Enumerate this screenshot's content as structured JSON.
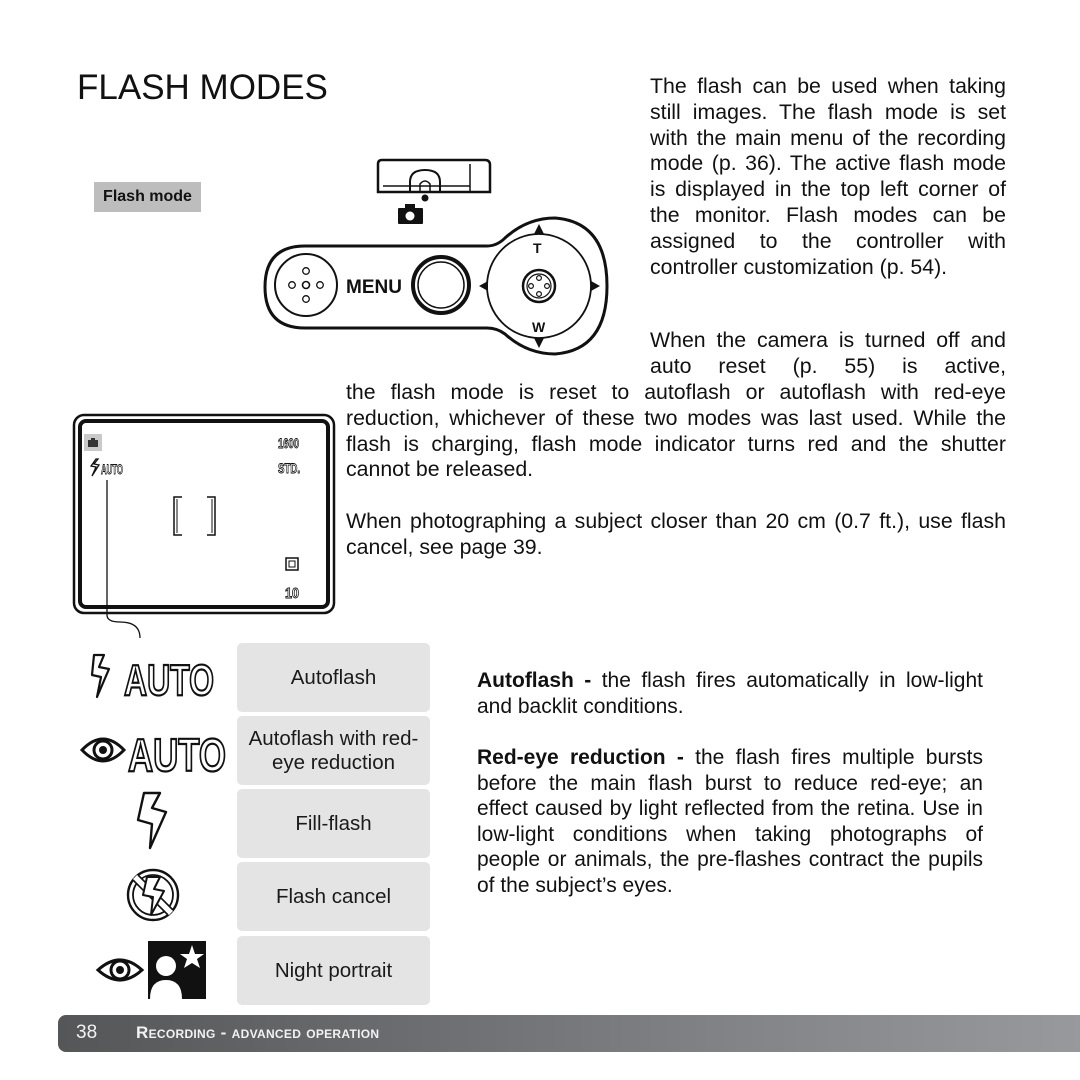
{
  "page": {
    "title": "FLASH MODES",
    "callout_label": "Flash mode",
    "intro_paragraph": "The flash can be used when taking still images. The flash mode is set with the main menu of the recording mode (p. 36). The active flash mode is displayed in the top left corner of the monitor. Flash modes can be assigned to the controller with controller customization (p. 54).",
    "reset_paragraph_part1": "When the camera is turned off and auto reset (p. 55) is active,",
    "reset_paragraph_part2": "the flash mode is reset to autoflash or autoflash with red-eye reduction, whichever of these two modes was last used. While the flash is charging, flash mode indicator turns red and the shutter cannot be released.",
    "close_subject_paragraph": "When photographing a subject closer than 20 cm (0.7 ft.), use flash cancel, see page 39."
  },
  "camera_diagram": {
    "menu_label": "MENU",
    "tele_label": "T",
    "wide_label": "W"
  },
  "monitor": {
    "iso": "1600",
    "quality": "STD.",
    "flash_indicator": "AUTO",
    "frame_count": "10"
  },
  "flash_modes": [
    {
      "icon": "autoflash-icon",
      "icon_text": "AUTO",
      "label": "Autoflash"
    },
    {
      "icon": "red-eye-autoflash-icon",
      "icon_text": "AUTO",
      "label": "Autoflash with red-eye reduction"
    },
    {
      "icon": "fill-flash-icon",
      "icon_text": "",
      "label": "Fill-flash"
    },
    {
      "icon": "flash-cancel-icon",
      "icon_text": "",
      "label": "Flash cancel"
    },
    {
      "icon": "night-portrait-icon",
      "icon_text": "",
      "label": "Night portrait"
    }
  ],
  "descriptions": [
    {
      "term": "Autoflash -",
      "text": " the flash fires automatically in low-light and backlit conditions."
    },
    {
      "term": "Red-eye reduction -",
      "text": " the flash fires multiple bursts before the main flash burst to reduce red-eye; an effect caused by light reflected from the retina. Use in low-light conditions when taking photographs of people or animals, the pre-flashes contract the pupils of the subject’s eyes."
    }
  ],
  "footer": {
    "page_number": "38",
    "section": "Recording - advanced operation"
  },
  "colors": {
    "label_bg": "#bdbdbd",
    "mode_box_bg": "#e4e4e4",
    "footer_start": "#555658",
    "footer_end": "#98999c"
  }
}
